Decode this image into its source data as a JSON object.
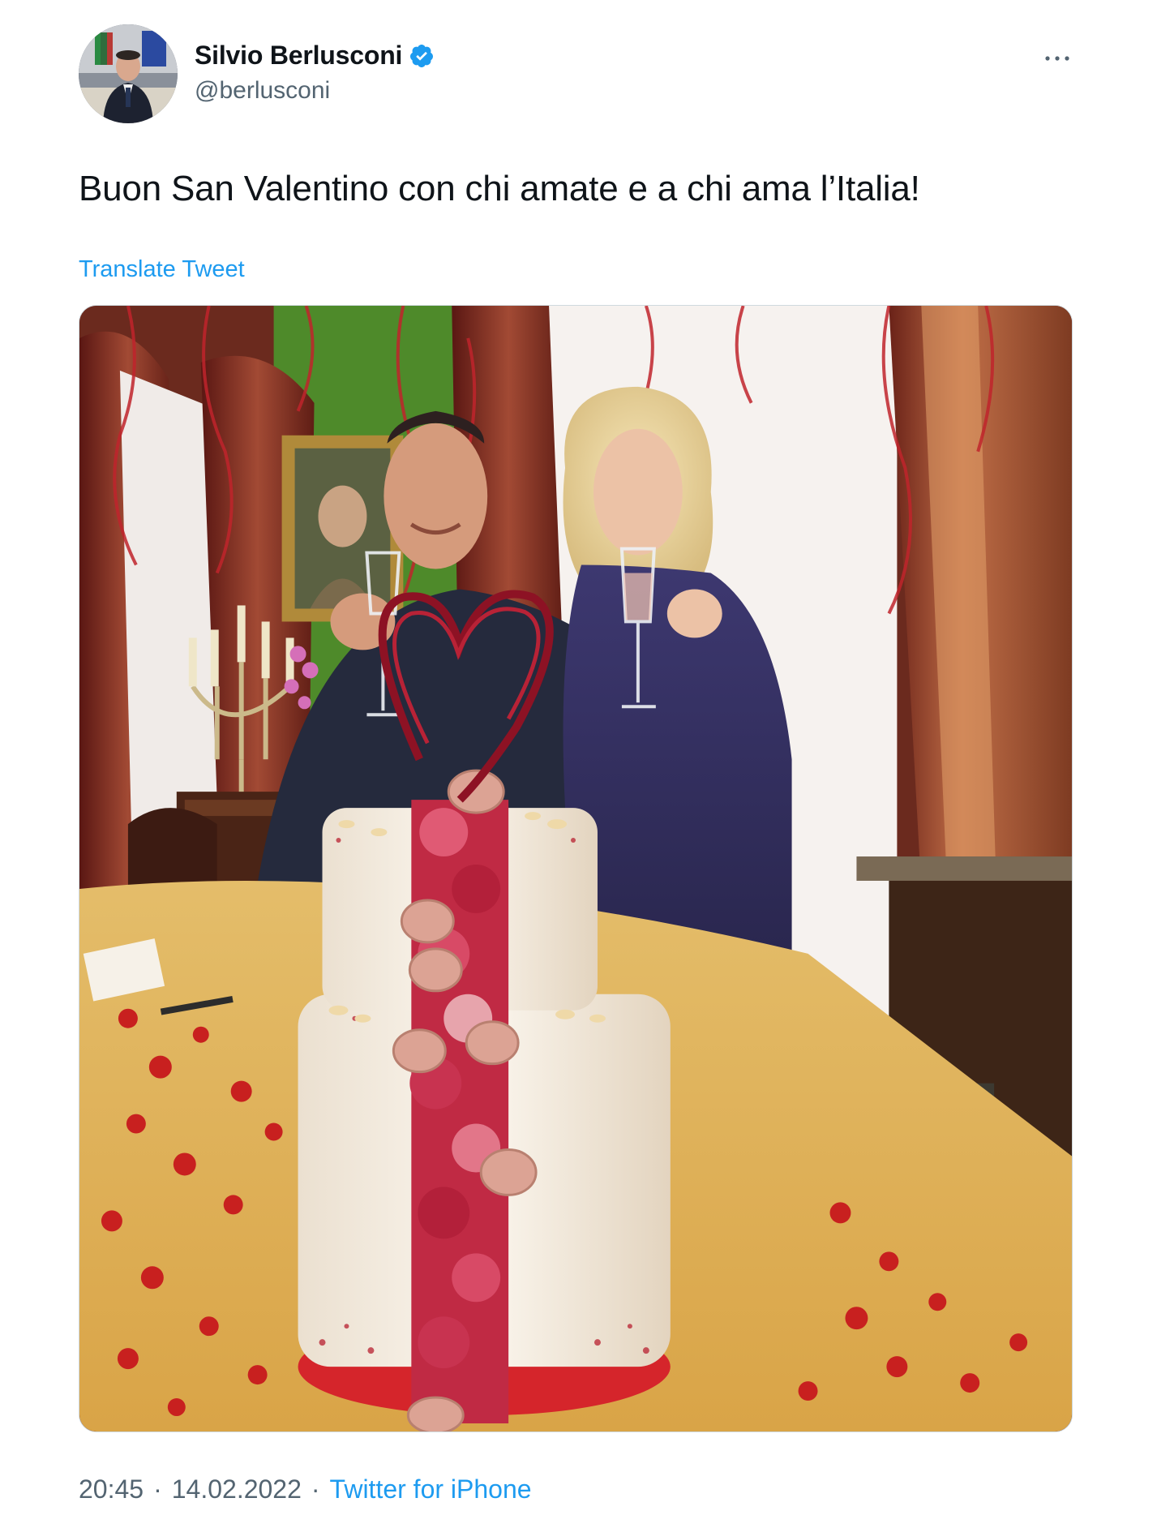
{
  "author": {
    "display_name": "Silvio Berlusconi",
    "handle": "@berlusconi",
    "verified": true,
    "avatar_icon": "profile-photo"
  },
  "tweet": {
    "text": "Buon San Valentino con chi amate e a chi ama l’Italia!",
    "translate_label": "Translate Tweet",
    "media_description_icon": "photo"
  },
  "meta": {
    "time": "20:45",
    "separator_1": "·",
    "date": "14.02.2022",
    "separator_2": "·",
    "source": "Twitter for iPhone"
  },
  "colors": {
    "link": "#1d9bf0",
    "secondary_text": "#536471",
    "primary_text": "#0f1419",
    "verified_badge": "#1d9bf0"
  }
}
